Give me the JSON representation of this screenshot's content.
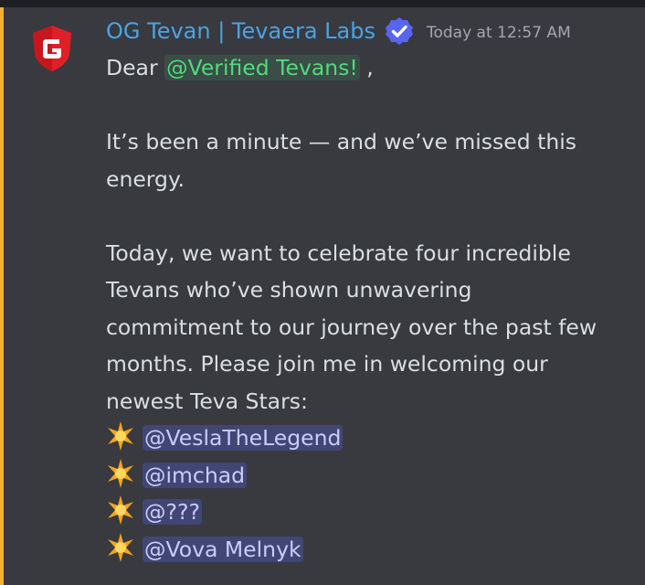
{
  "message": {
    "username": "OG Tevan | Tevaera Labs",
    "timestamp": "Today at 12:57 AM",
    "greeting_prefix": "Dear ",
    "role_mention": "@Verified Tevans!",
    "greeting_suffix": " ,",
    "paragraph1": [
      "It’s been a minute — and we’ve missed this",
      "energy."
    ],
    "paragraph2": [
      "Today, we want to celebrate four incredible",
      "Tevans who’ve shown unwavering",
      "commitment to our journey over the past few",
      "months. Please join me in welcoming our",
      "newest Teva Stars:"
    ],
    "stars": [
      {
        "icon": "glowing-star-icon",
        "mention": "@VeslaTheLegend"
      },
      {
        "icon": "glowing-star-icon",
        "mention": "@imchad"
      },
      {
        "icon": "glowing-star-icon",
        "mention": "@???"
      },
      {
        "icon": "glowing-star-icon",
        "mention": "@Vova Melnyk"
      }
    ]
  },
  "icons": {
    "avatar": "red-g-shield-logo",
    "badge": "verified-check-icon"
  },
  "colors": {
    "background": "#383a40",
    "mention_highlight_bar": "#f0b232",
    "username": "#4ba3e3",
    "role_mention": "#4fdc7c",
    "user_mention": "#c9cdfb",
    "text": "#dbdee1",
    "timestamp": "#a4a7ad",
    "verified_badge": "#5865f2"
  }
}
